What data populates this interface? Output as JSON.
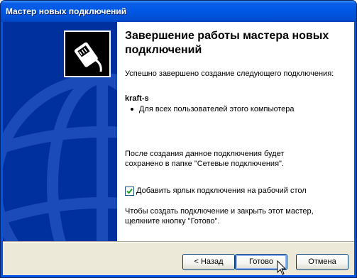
{
  "window": {
    "title": "Мастер новых подключений"
  },
  "wizard": {
    "heading": "Завершение работы мастера новых подключений",
    "success_text": "Успешно завершено создание следующего подключения:",
    "connection_name": "kraft-s",
    "connection_detail": "Для всех пользователей этого компьютера",
    "saved_text": "После создания данное подключения будет сохранено в папке \"Сетевые подключения\".",
    "shortcut_checkbox": {
      "label": "Добавить ярлык подключения на рабочий стол",
      "checked": true
    },
    "finish_text": "Чтобы создать подключение и закрыть этот мастер, щелкните кнопку \"Готово\"."
  },
  "buttons": {
    "back": "< Назад",
    "finish": "Готово",
    "cancel": "Отмена"
  },
  "colors": {
    "titlebar": "#0058e6",
    "left_panel": "#002f9e",
    "dialog_bg": "#ece9d8"
  }
}
